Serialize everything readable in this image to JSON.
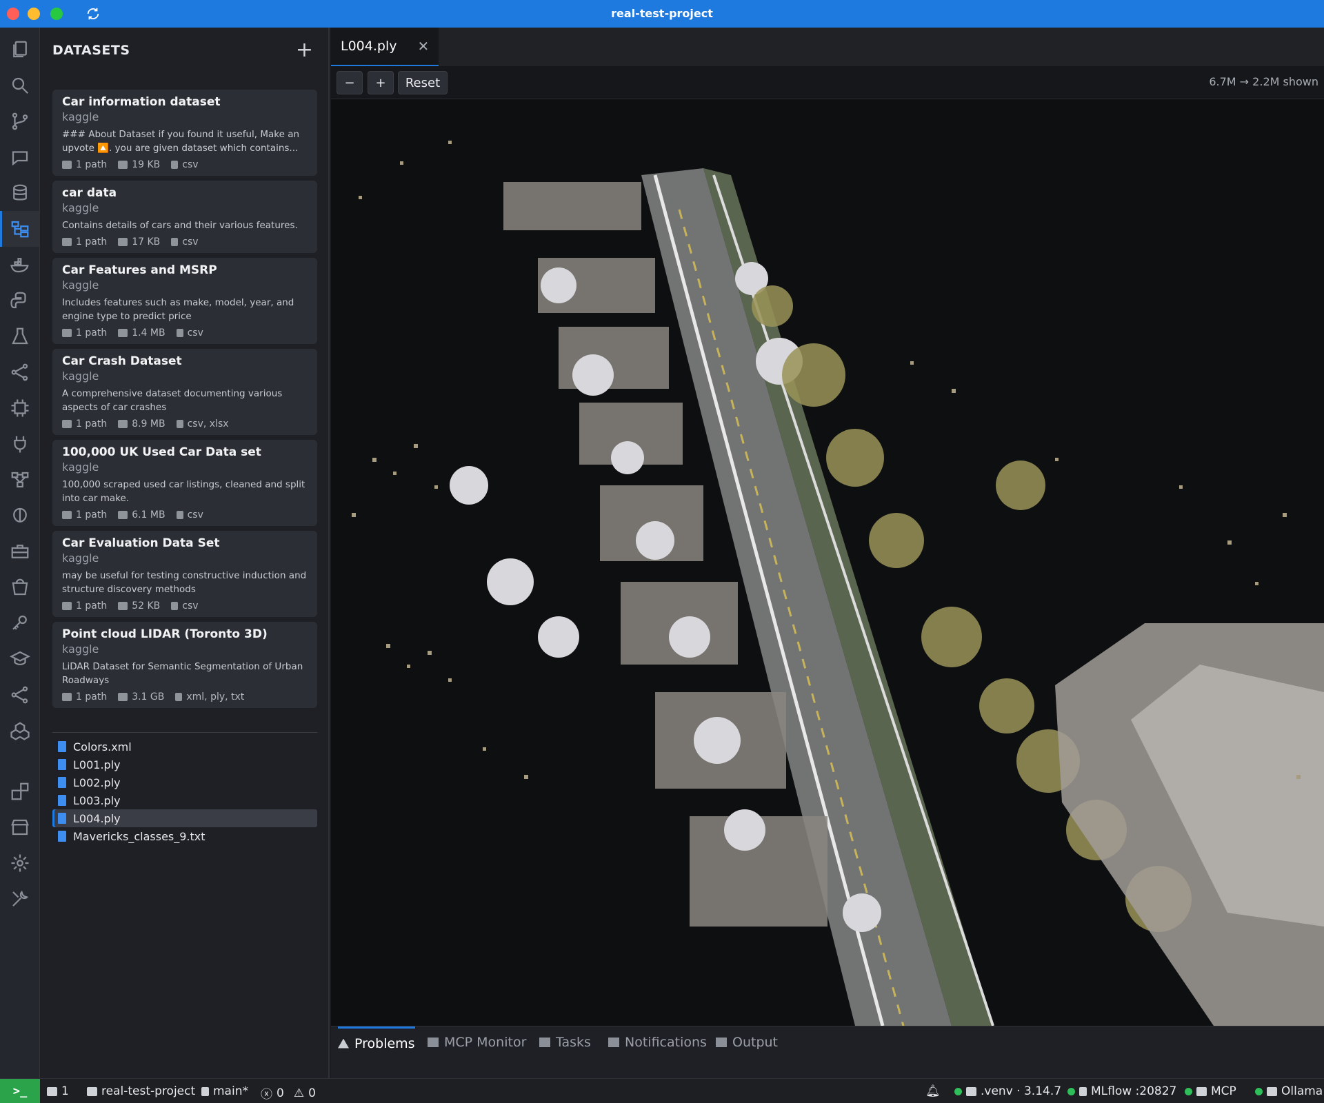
{
  "window": {
    "title": "real-test-project"
  },
  "sidebar": {
    "header": "DATASETS",
    "add_label": "+",
    "datasets": [
      {
        "title": "Car information dataset",
        "source": "kaggle",
        "description": "### About Dataset if you found it useful, Make an upvote 🔼. you are given dataset which contains...",
        "paths": "1 path",
        "size": "19 KB",
        "formats": "csv"
      },
      {
        "title": "car data",
        "source": "kaggle",
        "description": "Contains details of cars and their various features.",
        "paths": "1 path",
        "size": "17 KB",
        "formats": "csv"
      },
      {
        "title": "Car Features and MSRP",
        "source": "kaggle",
        "description": "Includes features such as make, model, year, and engine type to predict price",
        "paths": "1 path",
        "size": "1.4 MB",
        "formats": "csv"
      },
      {
        "title": "Car Crash Dataset",
        "source": "kaggle",
        "description": "A comprehensive dataset documenting various aspects of car crashes",
        "paths": "1 path",
        "size": "8.9 MB",
        "formats": "csv, xlsx"
      },
      {
        "title": "100,000 UK Used Car Data set",
        "source": "kaggle",
        "description": "100,000 scraped used car listings, cleaned and split into car make.",
        "paths": "1 path",
        "size": "6.1 MB",
        "formats": "csv"
      },
      {
        "title": "Car Evaluation Data Set",
        "source": "kaggle",
        "description": "may be useful for testing constructive induction and structure discovery methods",
        "paths": "1 path",
        "size": "52 KB",
        "formats": "csv"
      },
      {
        "title": "Point cloud LIDAR (Toronto 3D)",
        "source": "kaggle",
        "description": "LiDAR Dataset for Semantic Segmentation of Urban Roadways",
        "paths": "1 path",
        "size": "3.1 GB",
        "formats": "xml, ply, txt"
      }
    ],
    "files": [
      "Colors.xml",
      "L001.ply",
      "L002.ply",
      "L003.ply",
      "L004.ply",
      "Mavericks_classes_9.txt"
    ],
    "selected_file": "L004.ply"
  },
  "editor": {
    "tab_label": "L004.ply",
    "tab_close": "✕",
    "toolbar": {
      "zoom_out": "−",
      "zoom_in": "+",
      "reset": "Reset",
      "point_count": "6.7M → 2.2M shown"
    }
  },
  "panel": {
    "tabs": [
      "Problems",
      "MCP Monitor",
      "Tasks",
      "Notifications",
      "Output"
    ],
    "active_tab": "Problems"
  },
  "statusbar": {
    "terminal": ">_",
    "remotes": "1",
    "project": "real-test-project",
    "branch": "main*",
    "errors": "0",
    "warnings": "0",
    "python": ".venv · 3.14.7",
    "mlflow": "MLflow :20827",
    "mcp": "MCP",
    "ollama": "Ollama"
  },
  "colors": {
    "accent": "#1f7ae0",
    "status_ok": "#2fbf5a",
    "terminal": "#2aa34a"
  }
}
